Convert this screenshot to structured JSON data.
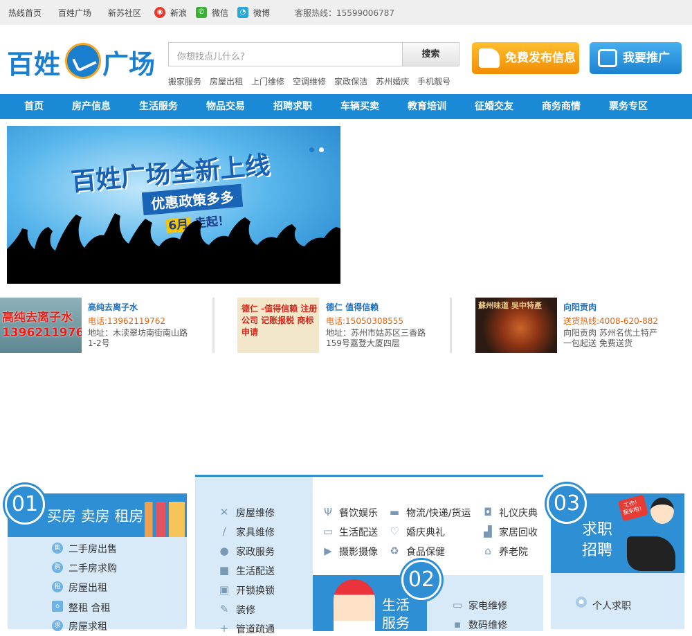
{
  "topbar": {
    "links": [
      "热线首页",
      "百姓广场",
      "新苏社区"
    ],
    "social": [
      "新浪",
      "微信",
      "微博"
    ],
    "hotline": "客服热线：15599006787"
  },
  "logo": {
    "left": "百姓",
    "right": "广场"
  },
  "search": {
    "placeholder": "你想找点儿什么?",
    "button": "搜索",
    "hotwords": [
      "搬家服务",
      "房屋出租",
      "上门维修",
      "空调维修",
      "家政保洁",
      "苏州婚庆",
      "手机靓号"
    ]
  },
  "actions": {
    "publish": "免费发布信息",
    "promote": "我要推广"
  },
  "nav": [
    "首页",
    "房产信息",
    "生活服务",
    "物品交易",
    "招聘求职",
    "车辆买卖",
    "教育培训",
    "征婚交友",
    "商务商情",
    "票务专区"
  ],
  "banner": {
    "title": "百姓广场全新上线",
    "subtitle": "优惠政策多多",
    "month": "6月",
    "go": "走起！"
  },
  "ads": [
    {
      "img_text": "高纯去离子水 13962119762",
      "title": "高纯去离子水",
      "phone": "电话:13962119762",
      "address": "地址：木渎翠坊南街南山路1-2号"
    },
    {
      "img_text": "德仁 -值得信赖 注册公司 记账报税 商标申请",
      "title": "德仁 值得信赖",
      "phone": "电话:15050308555",
      "address": "地址：苏州市姑苏区三香路159号嘉登大厦四层"
    },
    {
      "img_text": "蘇州味道 吳中特產",
      "title": "向阳贡肉",
      "phone": "送货热线:4008-620-882",
      "address": "向阳贡肉 苏州名优土特产 一包起送 免费送货"
    }
  ],
  "sections": {
    "house": {
      "num": "01",
      "title": "买房 卖房 租房",
      "items": [
        {
          "icon": "售",
          "label": "二手房出售"
        },
        {
          "icon": "购",
          "label": "二手房求购"
        },
        {
          "icon": "租",
          "label": "房屋出租"
        },
        {
          "icon": "home",
          "label": "整租 合租"
        },
        {
          "icon": "求",
          "label": "房屋求租"
        }
      ]
    },
    "repair": {
      "items": [
        "房屋维修",
        "家具维修",
        "家政服务",
        "生活配送",
        "开锁换锁",
        "装修",
        "管道疏通"
      ]
    },
    "life_top": {
      "items": [
        "餐饮娱乐",
        "物流/快递/货运",
        "礼仪庆典",
        "生活配送",
        "婚庆典礼",
        "家居回收",
        "摄影摄像",
        "食品保健",
        "养老院"
      ]
    },
    "life": {
      "num": "02",
      "title": "生活服务",
      "items": [
        "家电维修",
        "数码维修"
      ]
    },
    "job": {
      "num": "03",
      "title": "求职招聘",
      "badge": "工作！\n我来啦！",
      "items": [
        "个人求职"
      ]
    }
  },
  "colors": {
    "brand_blue": "#1b8ad6",
    "orange": "#f18d05",
    "light_panel": "#d8e9f7"
  }
}
